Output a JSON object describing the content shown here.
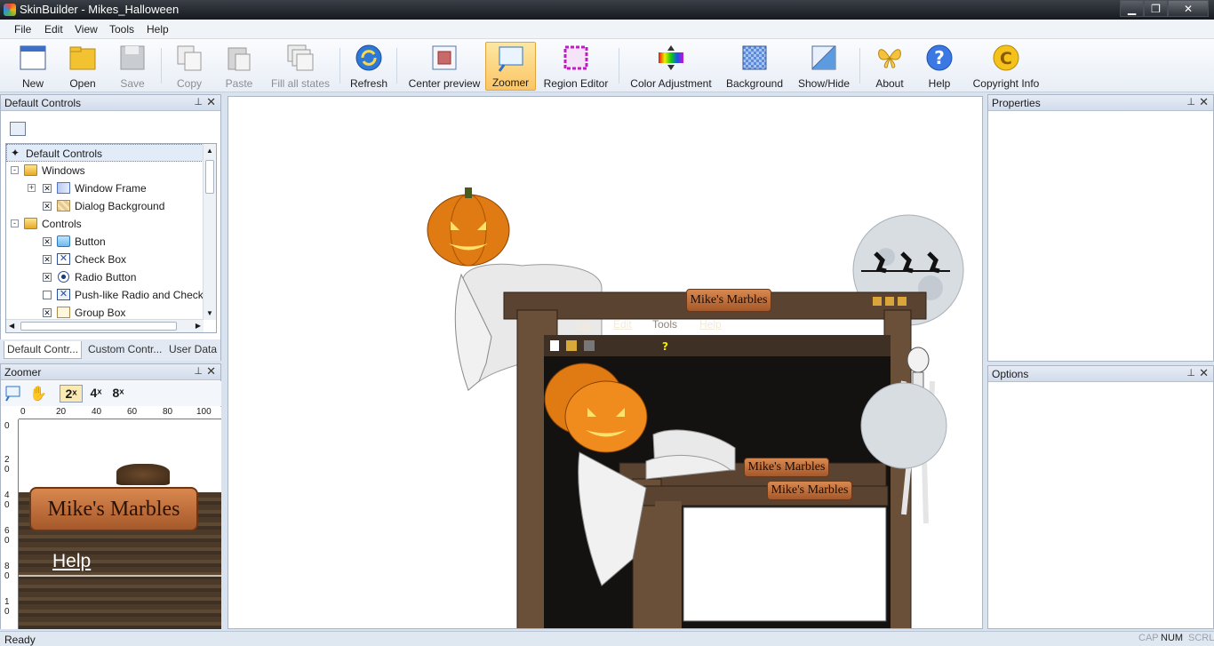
{
  "window": {
    "title": "SkinBuilder - Mikes_Halloween",
    "min": "▁",
    "max": "❐",
    "close": "✕"
  },
  "menu": [
    "File",
    "Edit",
    "View",
    "Tools",
    "Help"
  ],
  "toolbar": [
    {
      "label": "New",
      "state": "enabled",
      "icon": "new-icon"
    },
    {
      "label": "Open",
      "state": "enabled",
      "icon": "open-folder-icon"
    },
    {
      "label": "Save",
      "state": "disabled",
      "icon": "save-icon"
    },
    {
      "label": "Copy",
      "state": "disabled",
      "icon": "copy-icon"
    },
    {
      "label": "Paste",
      "state": "disabled",
      "icon": "paste-icon"
    },
    {
      "label": "Fill all states",
      "state": "disabled",
      "icon": "fill-states-icon"
    },
    {
      "label": "Refresh",
      "state": "enabled",
      "icon": "refresh-icon"
    },
    {
      "label": "Center preview",
      "state": "enabled",
      "icon": "center-preview-icon"
    },
    {
      "label": "Zoomer",
      "state": "active",
      "icon": "zoomer-icon"
    },
    {
      "label": "Region Editor",
      "state": "enabled",
      "icon": "region-editor-icon"
    },
    {
      "label": "Color Adjustment",
      "state": "enabled",
      "icon": "color-adjust-icon"
    },
    {
      "label": "Background",
      "state": "enabled",
      "icon": "background-icon"
    },
    {
      "label": "Show/Hide",
      "state": "enabled",
      "icon": "show-hide-icon"
    },
    {
      "label": "About",
      "state": "enabled",
      "icon": "about-butterfly-icon"
    },
    {
      "label": "Help",
      "state": "enabled",
      "icon": "help-icon"
    },
    {
      "label": "Copyright Info",
      "state": "enabled",
      "icon": "copyright-icon"
    }
  ],
  "default_controls": {
    "title": "Default Controls",
    "pin": "⍨",
    "close": "✕",
    "tree": [
      {
        "label": "Default Controls",
        "level": 0,
        "selected": true
      },
      {
        "label": "Windows",
        "level": 0,
        "expander": "-",
        "folder": true
      },
      {
        "label": "Window Frame",
        "level": 1,
        "expander": "+",
        "checked": true
      },
      {
        "label": "Dialog Background",
        "level": 1,
        "checked": true
      },
      {
        "label": "Controls",
        "level": 0,
        "expander": "-",
        "folder": true
      },
      {
        "label": "Button",
        "level": 1,
        "checked": true
      },
      {
        "label": "Check Box",
        "level": 1,
        "checked": true
      },
      {
        "label": "Radio Button",
        "level": 1,
        "checked": true
      },
      {
        "label": "Push-like Radio and Check",
        "level": 1,
        "checked": false
      },
      {
        "label": "Group Box",
        "level": 1,
        "checked": true
      }
    ],
    "tabs": [
      "Default Contr...",
      "Custom Contr...",
      "User Data"
    ]
  },
  "zoomer": {
    "title": "Zoomer",
    "zoom_levels": [
      "2ˣ",
      "4ˣ",
      "8ˣ"
    ],
    "ruler_h": [
      "0",
      "20",
      "40",
      "60",
      "80",
      "100"
    ],
    "ruler_v": [
      "0",
      "2\n0",
      "4\n0",
      "6\n0",
      "8\n0",
      "1\n0"
    ],
    "preview_plaque": "Mike's Marbles",
    "preview_menu": "Help"
  },
  "preview": {
    "plaque_main": "Mike's Marbles",
    "plaque_inner1": "Mike's Marbles",
    "plaque_inner2": "Mike's Marbles",
    "menu": [
      "File",
      "Edit",
      "Tools",
      "Help"
    ]
  },
  "properties": {
    "title": "Properties"
  },
  "options": {
    "title": "Options"
  },
  "status": {
    "text": "Ready",
    "indicators": [
      "CAP",
      "NUM",
      "SCRL"
    ]
  }
}
